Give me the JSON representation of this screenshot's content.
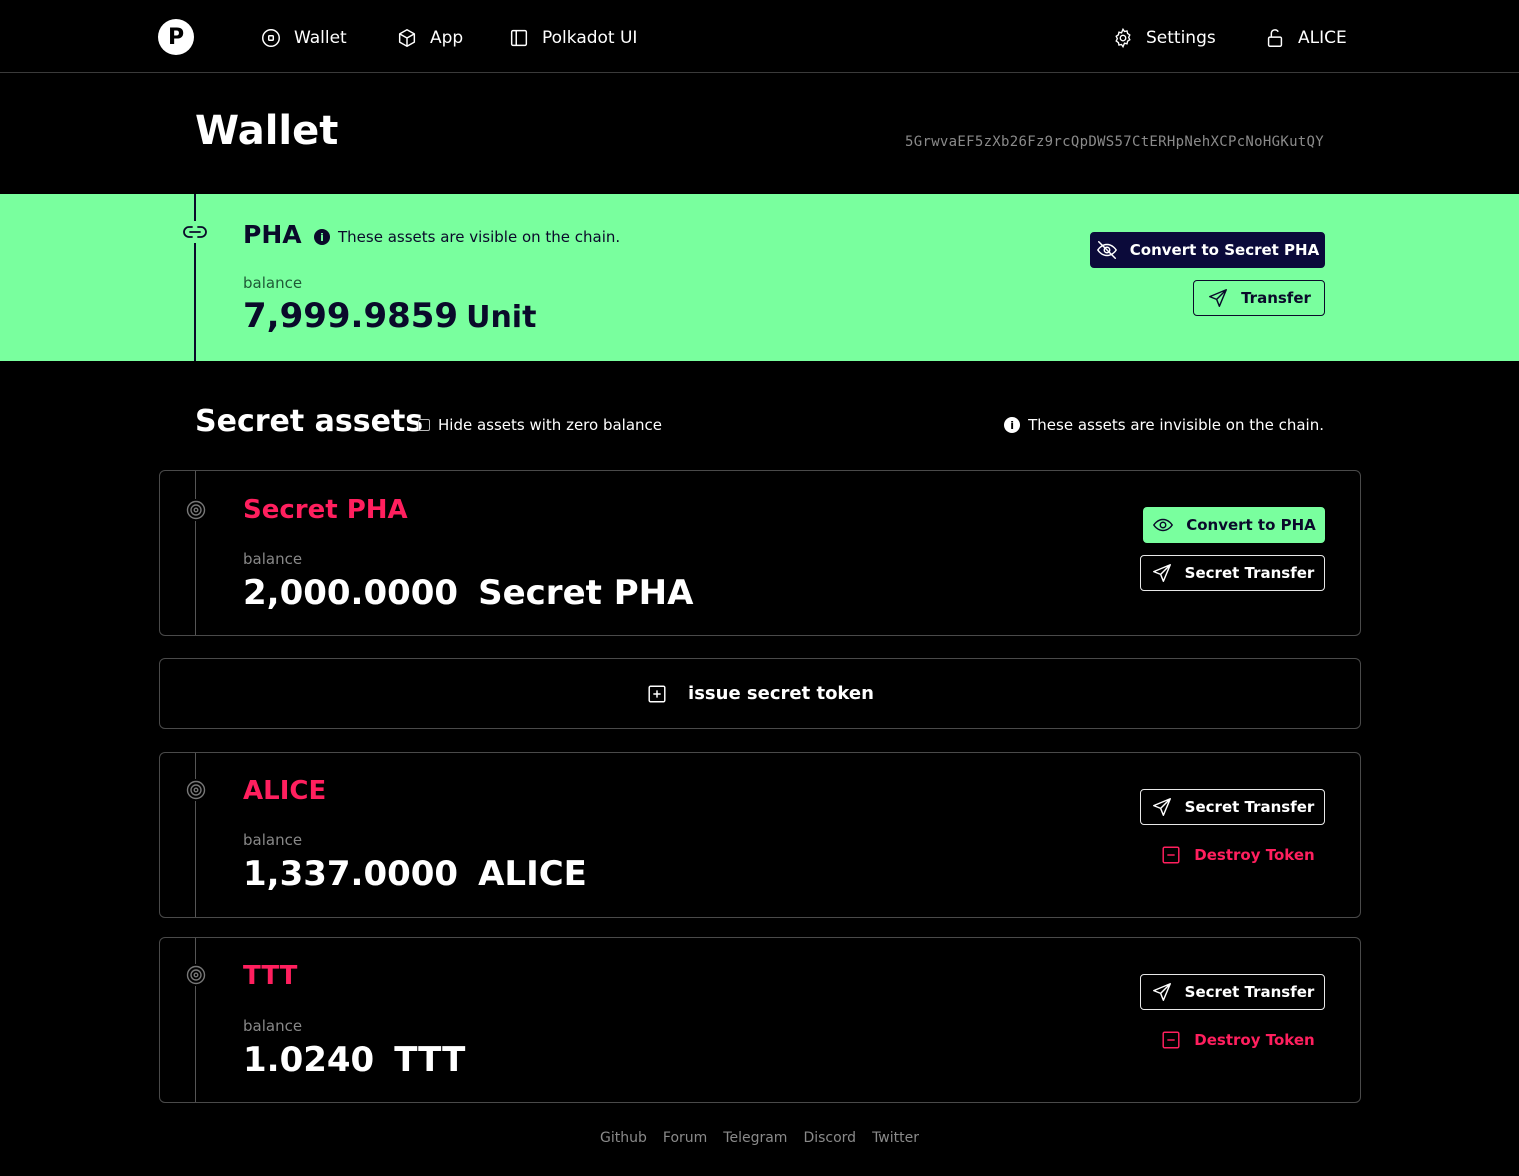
{
  "nav": {
    "logo_glyph": "P",
    "items": [
      {
        "label": "Wallet",
        "icon": "circle-dot-icon"
      },
      {
        "label": "App",
        "icon": "cube-icon"
      },
      {
        "label": "Polkadot UI",
        "icon": "panel-icon"
      }
    ],
    "settings_label": "Settings",
    "account_label": "ALICE"
  },
  "page": {
    "title": "Wallet",
    "address": "5GrwvaEF5zXb26Fz9rcQpDWS57CtERHpNehXCPcNoHGKutQY"
  },
  "pha": {
    "name": "PHA",
    "info_glyph": "i",
    "note": "These assets are visible on the chain.",
    "balance_label": "balance",
    "balance": "7,999.9859",
    "unit": "Unit",
    "convert_label": "Convert to Secret PHA",
    "transfer_label": "Transfer",
    "band_color": "#79ff9e"
  },
  "secret": {
    "title": "Secret assets",
    "hide_zero_label": "Hide assets with zero balance",
    "hide_zero_checked": false,
    "info_glyph": "i",
    "note": "These assets are invisible on the chain.",
    "issue_label": "issue secret token",
    "assets": [
      {
        "name": "Secret PHA",
        "balance_label": "balance",
        "balance": "2,000.0000",
        "symbol": "Secret PHA",
        "primary_action": "Convert to PHA",
        "transfer_label": "Secret Transfer"
      },
      {
        "name": "ALICE",
        "balance_label": "balance",
        "balance": "1,337.0000",
        "symbol": "ALICE",
        "transfer_label": "Secret Transfer",
        "destroy_label": "Destroy Token"
      },
      {
        "name": "TTT",
        "balance_label": "balance",
        "balance": "1.0240",
        "symbol": "TTT",
        "transfer_label": "Secret Transfer",
        "destroy_label": "Destroy Token"
      }
    ]
  },
  "footer": {
    "links": [
      "Github",
      "Forum",
      "Telegram",
      "Discord",
      "Twitter"
    ]
  },
  "colors": {
    "accent_green": "#79ff9e",
    "accent_red": "#ff1f5e",
    "navy": "#0b0a3a"
  }
}
